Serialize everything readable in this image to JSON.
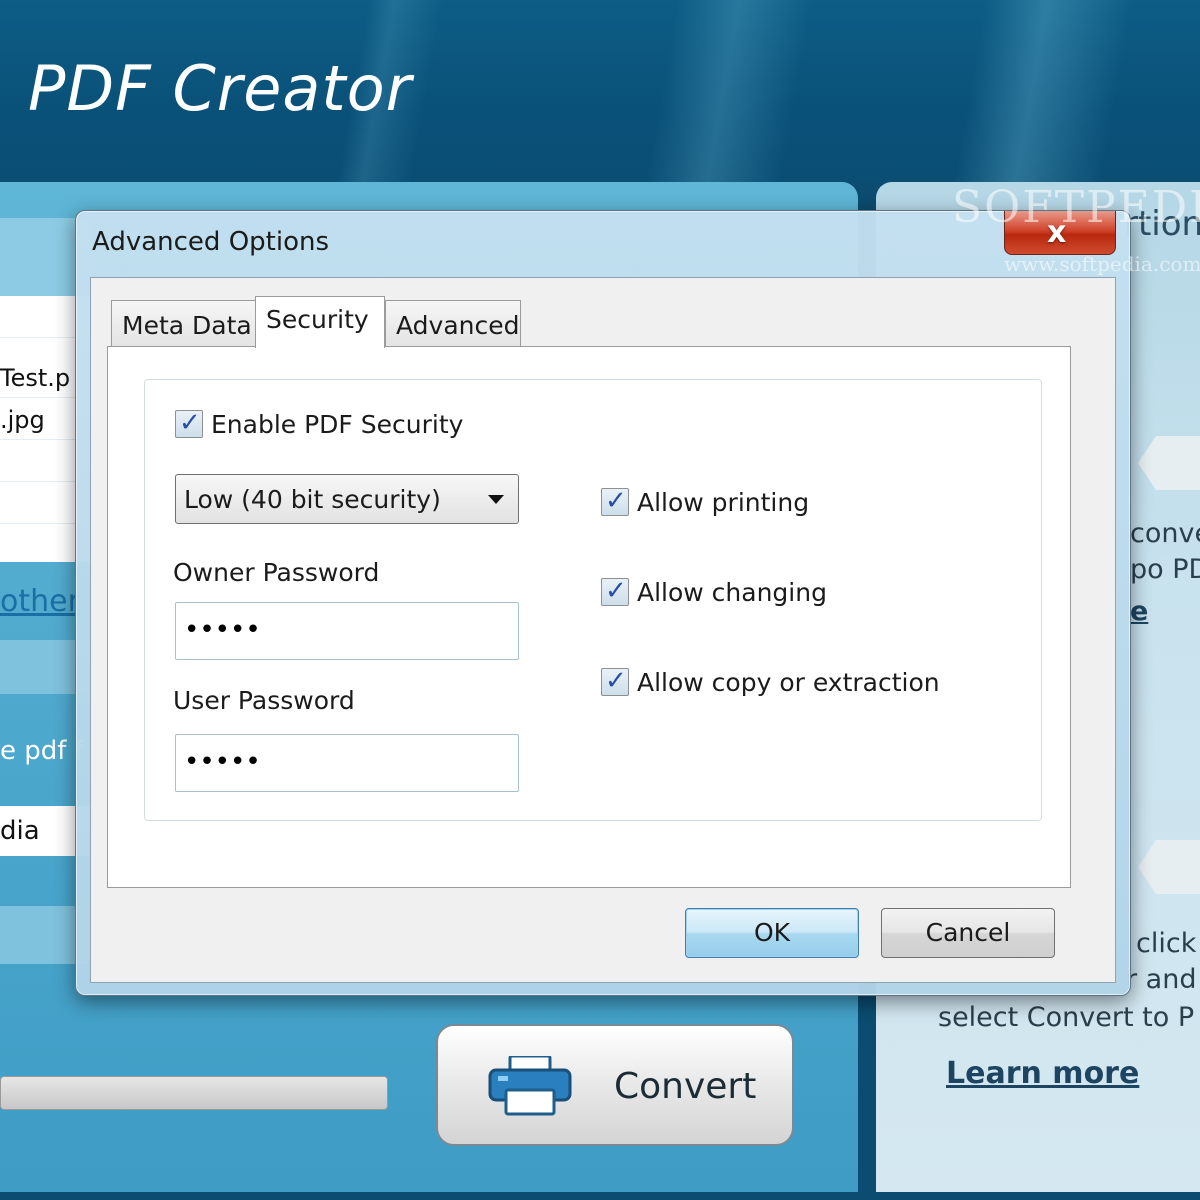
{
  "app": {
    "title": "PDF Creator",
    "file_list": [
      "Test.p",
      ".jpg"
    ],
    "other_link": "other",
    "pdf_label": "e pdf f",
    "output_value": "dia",
    "convert_label": "Convert"
  },
  "right_panel": {
    "heading": "rtion",
    "text_lines": [
      "conve",
      "po PD",
      "e"
    ],
    "text_lines_2": [
      "click",
      "r and",
      "select Convert to P"
    ],
    "learn_more": "Learn more",
    "watermark": "SOFTPEDIA",
    "watermark_url": "www.softpedia.com"
  },
  "dialog": {
    "title": "Advanced Options",
    "close_glyph": "x",
    "tabs": [
      {
        "label": "Meta Data",
        "active": false
      },
      {
        "label": "Security",
        "active": true
      },
      {
        "label": "Advanced",
        "active": false
      }
    ],
    "security": {
      "enable_label": "Enable PDF Security",
      "enable_checked": true,
      "level_selected": "Low (40 bit security)",
      "owner_password_label": "Owner Password",
      "owner_password_value": "12345",
      "user_password_label": "User Password",
      "user_password_value": "12345",
      "permissions": [
        {
          "label": "Allow printing",
          "checked": true
        },
        {
          "label": "Allow changing",
          "checked": true
        },
        {
          "label": "Allow copy or extraction",
          "checked": true
        }
      ]
    },
    "ok_label": "OK",
    "cancel_label": "Cancel"
  },
  "colors": {
    "header_blue": "#0d5d86",
    "panel_blue": "#3e9cc5",
    "close_red": "#d2452d",
    "link_blue": "#1a6fa4"
  }
}
